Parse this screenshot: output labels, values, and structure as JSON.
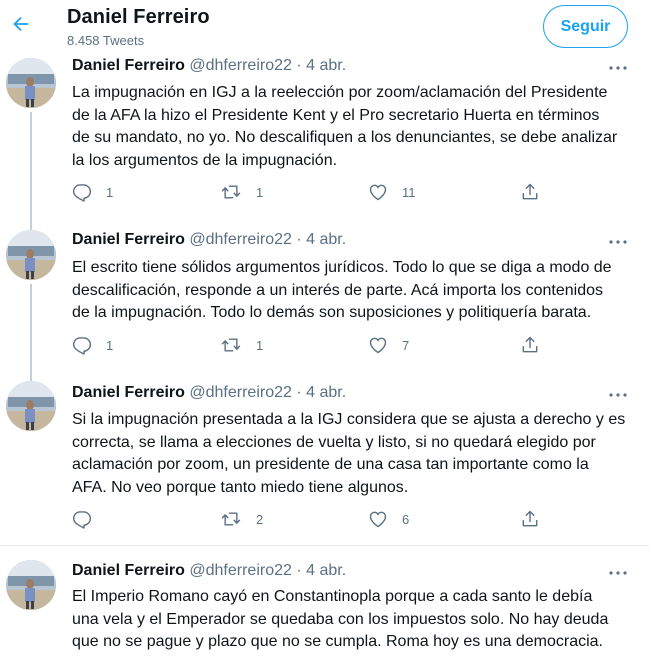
{
  "header": {
    "title": "Daniel Ferreiro",
    "subtitle": "8.458 Tweets",
    "follow_label": "Seguir",
    "back_icon": "arrow-left-icon"
  },
  "colors": {
    "accent": "#1da1f2",
    "secondary_text": "#5b7083",
    "divider": "#ebeef0"
  },
  "tweets": [
    {
      "name": "Daniel Ferreiro",
      "meta": "@dhferreiro22 · 4 abr.",
      "text": "La impugnación en IGJ a la reelección por zoom/aclamación del Presidente\nde la AFA la hizo el Presidente Kent y el Pro secretario Huerta en términos\nde su mandato, no yo. No descalifiquen a los denunciantes, se debe analizar\nla los argumentos de la impugnación.",
      "replies": "1",
      "retweets": "1",
      "likes": "11"
    },
    {
      "name": "Daniel Ferreiro",
      "meta": "@dhferreiro22 · 4 abr.",
      "text": "El escrito tiene sólidos argumentos jurídicos. Todo lo que se diga a modo de\ndescalificación, responde a un interés de parte. Acá importa los contenidos\nde la impugnación. Todo lo demás son suposiciones y politiquería barata.",
      "replies": "1",
      "retweets": "1",
      "likes": "7"
    },
    {
      "name": "Daniel Ferreiro",
      "meta": "@dhferreiro22 · 4 abr.",
      "text": "Si la impugnación presentada a la IGJ considera que se ajusta a derecho y es\ncorrecta, se llama a elecciones de vuelta y listo, si no quedará elegido por\naclamación por zoom, un presidente de una casa tan importante como la\nAFA. No veo porque tanto miedo tiene algunos.",
      "replies": "",
      "retweets": "2",
      "likes": "6"
    },
    {
      "name": "Daniel Ferreiro",
      "meta": "@dhferreiro22 · 4 abr.",
      "text": "El Imperio Romano cayó en Constantinopla porque a cada santo le debía\nuna vela y el Emperador se quedaba con los impuestos solo. No hay deuda\nque no se pague y plazo que no se cumpla. Roma hoy es una democracia."
    }
  ]
}
